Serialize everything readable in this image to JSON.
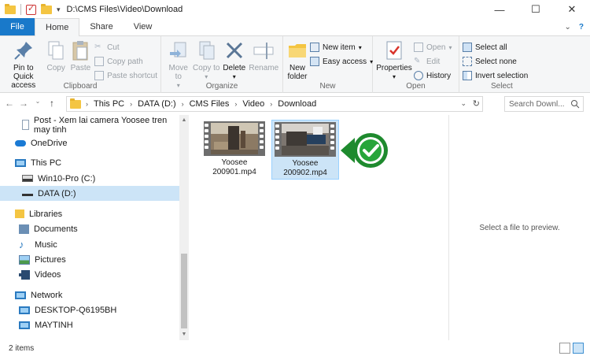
{
  "title": "D:\\CMS Files\\Video\\Download",
  "ribbon_tabs": [
    "File",
    "Home",
    "Share",
    "View"
  ],
  "clipboard": {
    "pin_label": "Pin to Quick access",
    "copy": "Copy",
    "paste": "Paste",
    "cut": "Cut",
    "copy_path": "Copy path",
    "paste_shortcut": "Paste shortcut",
    "group": "Clipboard"
  },
  "organize": {
    "move_to": "Move to",
    "copy_to": "Copy to",
    "delete": "Delete",
    "rename": "Rename",
    "group": "Organize"
  },
  "new": {
    "new_folder": "New folder",
    "new_item": "New item",
    "easy_access": "Easy access",
    "group": "New"
  },
  "open": {
    "properties": "Properties",
    "open": "Open",
    "edit": "Edit",
    "history": "History",
    "group": "Open"
  },
  "select": {
    "select_all": "Select all",
    "select_none": "Select none",
    "invert": "Invert selection",
    "group": "Select"
  },
  "address": {
    "crumbs": [
      "This PC",
      "DATA (D:)",
      "CMS Files",
      "Video",
      "Download"
    ],
    "search_placeholder": "Search Downl..."
  },
  "nav": [
    {
      "label": "Post - Xem lai camera Yoosee tren may tinh",
      "icon": "document-icon"
    },
    {
      "label": "OneDrive",
      "icon": "cloud-icon"
    },
    {
      "label": "This PC",
      "icon": "computer-icon"
    },
    {
      "label": "Win10-Pro (C:)",
      "icon": "drive-icon"
    },
    {
      "label": "DATA (D:)",
      "icon": "drive-icon"
    },
    {
      "label": "Libraries",
      "icon": "library-icon"
    },
    {
      "label": "Documents",
      "icon": "documents-icon"
    },
    {
      "label": "Music",
      "icon": "music-icon"
    },
    {
      "label": "Pictures",
      "icon": "pictures-icon"
    },
    {
      "label": "Videos",
      "icon": "videos-icon"
    },
    {
      "label": "Network",
      "icon": "network-icon"
    },
    {
      "label": "DESKTOP-Q6195BH",
      "icon": "computer-icon"
    },
    {
      "label": "MAYTINH",
      "icon": "computer-icon"
    }
  ],
  "files": [
    {
      "name1": "Yoosee",
      "name2": "200901.mp4",
      "selected": false
    },
    {
      "name1": "Yoosee",
      "name2": "200902.mp4",
      "selected": true
    }
  ],
  "preview_text": "Select a file to preview.",
  "status": "2 items",
  "colors": {
    "accent": "#1979ca",
    "selection": "#cce4f7",
    "check_green": "#27a53a"
  }
}
